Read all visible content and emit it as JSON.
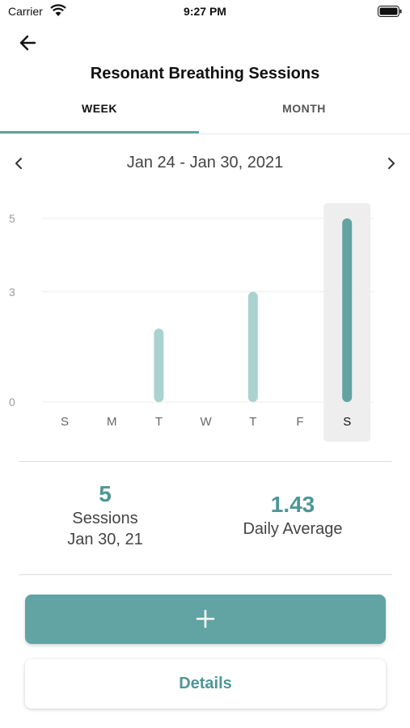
{
  "status_bar": {
    "carrier": "Carrier",
    "time": "9:27 PM",
    "icons": [
      "wifi-icon",
      "battery-icon"
    ]
  },
  "header": {
    "back_icon": "arrow-left-icon",
    "title": "Resonant Breathing Sessions"
  },
  "tabs": [
    {
      "label": "WEEK",
      "selected": true
    },
    {
      "label": "MONTH",
      "selected": false
    }
  ],
  "date_nav": {
    "prev_icon": "chevron-left-icon",
    "range": "Jan 24 - Jan 30, 2021",
    "next_icon": "chevron-right-icon"
  },
  "chart_data": {
    "type": "bar",
    "categories": [
      "S",
      "M",
      "T",
      "W",
      "T",
      "F",
      "S"
    ],
    "values": [
      0,
      0,
      2,
      0,
      3,
      0,
      5
    ],
    "yticks": [
      0,
      3,
      5
    ],
    "ylim": [
      0,
      5
    ],
    "selected_index": 6,
    "grid": true,
    "colors": {
      "bar": "#aad3d0",
      "bar_selected": "#62a3a3",
      "highlight": "#eeeeee",
      "grid": "#ececec",
      "tick": "#9a9a9a"
    }
  },
  "stats": {
    "sessions": {
      "value": "5",
      "label": "Sessions",
      "date": "Jan 30, 21"
    },
    "average": {
      "value": "1.43",
      "label": "Daily Average"
    }
  },
  "actions": {
    "add_icon": "plus-icon",
    "details_label": "Details"
  },
  "colors": {
    "accent": "#62a3a3",
    "accent_text": "#4e9696"
  }
}
